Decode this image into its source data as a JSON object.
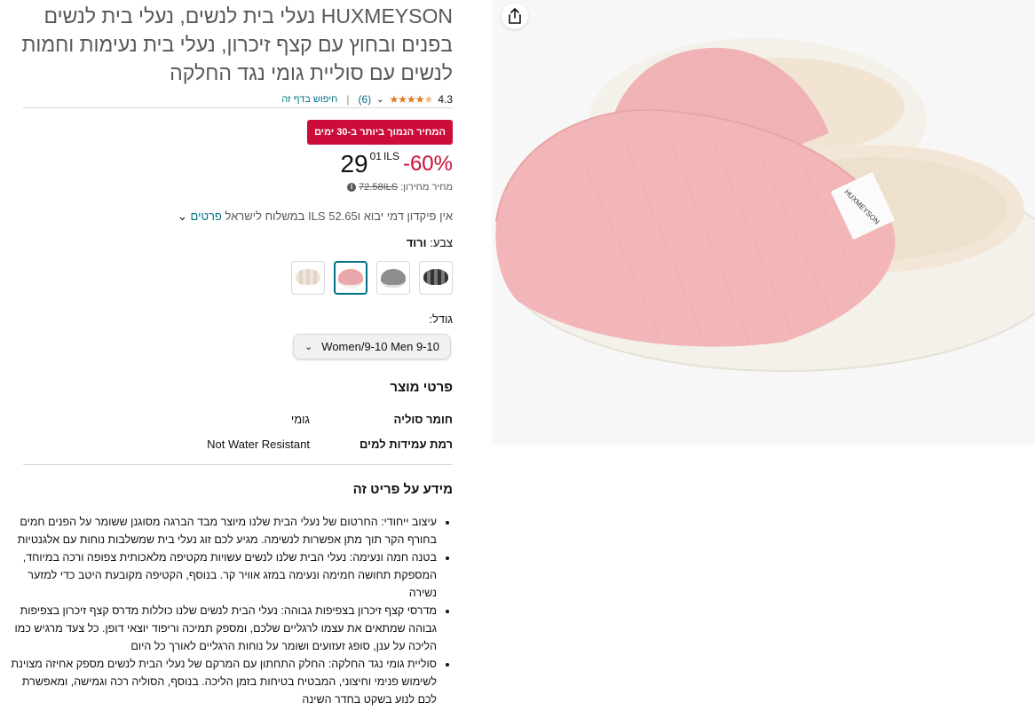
{
  "title": {
    "line1": "HUXMEYSON נעלי בית לנשים, נעלי בית לנשים",
    "line2": "בפנים ובחוץ עם קצף זיכרון, נעלי בית נעימות וחמות",
    "line3": "לנשים עם סוליית גומי נגד החלקה"
  },
  "rating": {
    "value": "4.3",
    "stars": 4.3,
    "count": "(6)",
    "search_link": "חיפוש בדף זה"
  },
  "deal": {
    "badge": "המחיר הנמוך ביותר ב-30 ימים"
  },
  "price": {
    "discount": "-60%",
    "whole": "29",
    "fraction": "01",
    "currency": "ILS",
    "list_label": "מחיר מחירון:",
    "list_value": "72.58ILS"
  },
  "shipping": {
    "text": "אין פיקדון דמי יבוא ו52.65 ILS במשלוח לישראל",
    "details_link": "פרטים"
  },
  "color": {
    "label": "צבע:",
    "selected": "ורוד",
    "swatches": [
      "black",
      "grey",
      "pink",
      "beige"
    ]
  },
  "size": {
    "label": "גודל:",
    "selected": "Women/9-10 Men 9-10"
  },
  "product_details": {
    "heading": "פרטי מוצר",
    "rows": [
      {
        "key": "חומר סוליה",
        "value": "גומי"
      },
      {
        "key": "רמת עמידות למים",
        "value": "Not Water Resistant"
      }
    ]
  },
  "about": {
    "heading": "מידע על פריט זה",
    "bullets": [
      "עיצוב ייחודי: החרטום של נעלי הבית שלנו מיוצר מבד הברגה מסוגנן ששומר על הפנים חמים בחורף הקר תוך מתן אפשרות לנשימה. מגיע לכם זוג נעלי בית שמשלבות נוחות עם אלגנטיות",
      "בטנה חמה ונעימה: נעלי הבית שלנו לנשים עשויות מקטיפה מלאכותית צפופה ורכה במיוחד, המספקת תחושה חמימה ונעימה במזג אוויר קר. בנוסף, הקטיפה מקובעת היטב כדי למזער נשירה",
      "מדרסי קצף זיכרון בצפיפות גבוהה: נעלי הבית לנשים שלנו כוללות מדרס קצף זיכרון בצפיפות גבוהה שמתאים את עצמו לרגליים שלכם, ומספק תמיכה וריפוד יוצאי דופן. כל צעד מרגיש כמו הליכה על ענן, סופג זעזועים ושומר על נוחות הרגליים לאורך כל היום",
      "סוליית גומי נגד החלקה: החלק התחתון עם המרקם של נעלי הבית לנשים מספק אחיזה מצוינת לשימוש פנימי וחיצוני, המבטיח בטיחות בזמן הליכה. בנוסף, הסוליה רכה וגמישה, ומאפשרת לכם לנוע בשקט בחדר השינה"
    ]
  },
  "image": {
    "brand_tag": "HUXMEYSON",
    "colors": {
      "slipper": "#f2b6b8",
      "sole": "#f4f1ea",
      "lining": "#f3e6d6"
    }
  }
}
